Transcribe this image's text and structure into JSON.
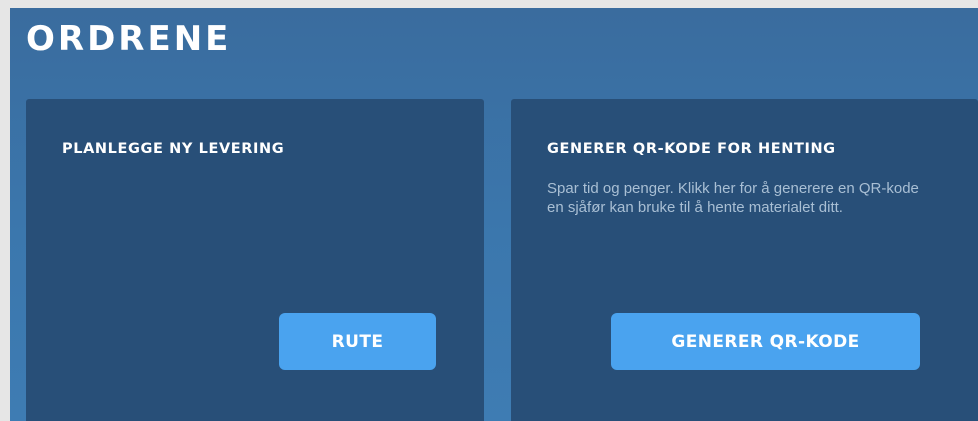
{
  "page": {
    "title": "ORDRENE"
  },
  "cards": {
    "delivery": {
      "title": "PLANLEGGE NY LEVERING",
      "button_label": "RUTE"
    },
    "qr": {
      "title": "GENERER QR-KODE FOR HENTING",
      "description": "Spar tid og penger. Klikk her for å generere en QR-kode en sjåfør kan bruke til å hente materialet ditt.",
      "button_label": "GENERER QR-KODE"
    }
  },
  "colors": {
    "page_background": "#e6e6e6",
    "header_background": "#3b77ad",
    "card_background": "#284f78",
    "button_accent": "#4aa3ef",
    "description_text": "#a9bfd4",
    "title_text": "#ffffff"
  }
}
